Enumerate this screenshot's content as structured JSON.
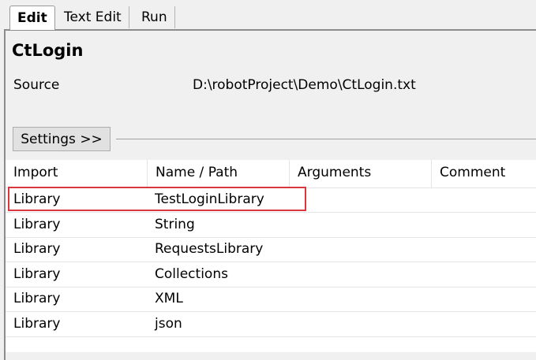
{
  "tabs": [
    "Edit",
    "Text Edit",
    "Run"
  ],
  "suite": {
    "name": "CtLogin",
    "source_label": "Source",
    "source_value": "D:\\robotProject\\Demo\\CtLogin.txt"
  },
  "settings_button": "Settings >>",
  "table": {
    "columns": [
      "Import",
      "Name / Path",
      "Arguments",
      "Comment"
    ],
    "rows": [
      {
        "import": "Library",
        "name": "TestLoginLibrary"
      },
      {
        "import": "Library",
        "name": "String"
      },
      {
        "import": "Library",
        "name": "RequestsLibrary"
      },
      {
        "import": "Library",
        "name": "Collections"
      },
      {
        "import": "Library",
        "name": "XML"
      },
      {
        "import": "Library",
        "name": "json"
      }
    ]
  },
  "highlight_color": "#d9363e"
}
